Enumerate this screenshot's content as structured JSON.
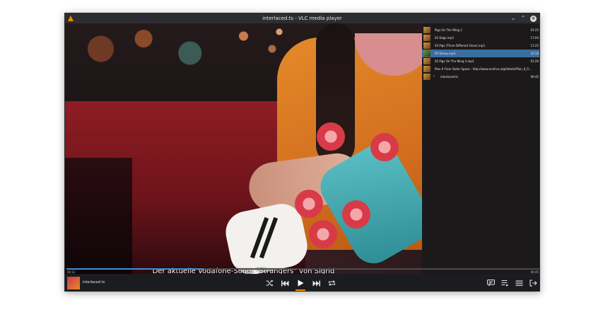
{
  "window": {
    "title": "interlaced.ts - VLC media player"
  },
  "video": {
    "subtitle": "Der aktuelle Vodafone-Song: \"Strangers\" von Sigrid"
  },
  "playlist": {
    "items": [
      {
        "title": "Pigs On The Wing 1",
        "duration": "01:25",
        "selected": false,
        "nested": false
      },
      {
        "title": "02 Dogs.mp3",
        "duration": "17:04",
        "selected": false,
        "nested": false
      },
      {
        "title": "03 Pigs (Three Different Ones).mp3",
        "duration": "11:25",
        "selected": false,
        "nested": false
      },
      {
        "title": "04 Sheep.mp3",
        "duration": "10:18",
        "selected": true,
        "nested": false
      },
      {
        "title": "05 Pigs On The Wing 2.mp3",
        "duration": "01:26",
        "selected": false,
        "nested": false
      },
      {
        "title": "Plan 9 From Outer Space - http://www.archive.org/details/Plan_9_Fr...",
        "duration": "",
        "selected": false,
        "nested": false
      },
      {
        "title": "interlaced.ts",
        "duration": "00:45",
        "selected": false,
        "nested": true
      }
    ]
  },
  "seek": {
    "current": "00:12",
    "total": "00:45",
    "progress": 0.29
  },
  "now_playing": {
    "title": "interlaced.ts"
  },
  "icons": {
    "shuffle": "shuffle-icon",
    "prev": "previous-icon",
    "play": "play-icon",
    "next": "next-icon",
    "repeat": "repeat-icon",
    "subtitles": "subtitles-icon",
    "playlist": "playlist-icon",
    "menu": "menu-icon",
    "exit": "exit-fullscreen-icon"
  },
  "colors": {
    "accent": "#3d8fd6",
    "play_accent": "#f08c00",
    "selection": "#3b6ea0"
  }
}
